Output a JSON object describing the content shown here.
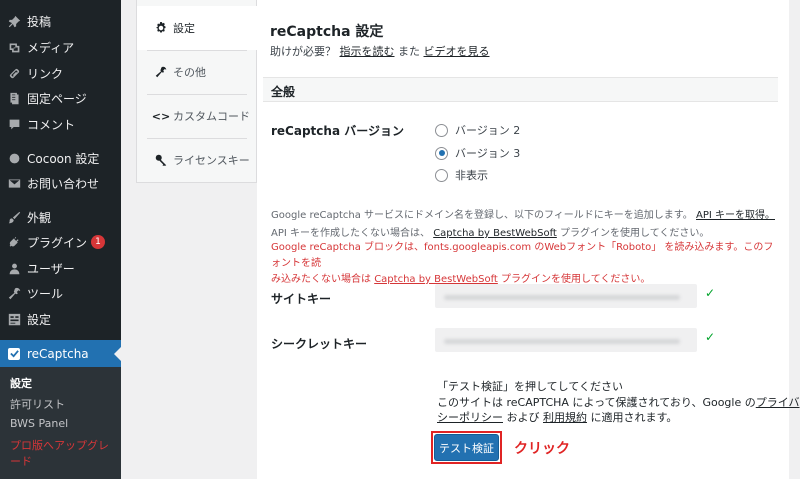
{
  "sidebar": {
    "items": [
      {
        "label": "投稿",
        "icon": "pushpin-icon"
      },
      {
        "label": "メディア",
        "icon": "media-icon"
      },
      {
        "label": "リンク",
        "icon": "link-icon"
      },
      {
        "label": "固定ページ",
        "icon": "page-icon"
      },
      {
        "label": "コメント",
        "icon": "comment-icon"
      },
      {
        "label": "Cocoon 設定",
        "icon": "circle-icon"
      },
      {
        "label": "お問い合わせ",
        "icon": "mail-icon"
      },
      {
        "label": "外観",
        "icon": "brush-icon"
      },
      {
        "label": "プラグイン",
        "icon": "plugin-icon",
        "badge": "1"
      },
      {
        "label": "ユーザー",
        "icon": "user-icon"
      },
      {
        "label": "ツール",
        "icon": "wrench-icon"
      },
      {
        "label": "設定",
        "icon": "settings-icon"
      }
    ],
    "active": {
      "label": "reCaptcha",
      "icon": "checkbox-icon"
    },
    "submenu": [
      "設定",
      "許可リスト",
      "BWS Panel",
      "プロ版へアップグレード"
    ]
  },
  "tabs": [
    {
      "label": "設定",
      "icon": "gear-icon"
    },
    {
      "label": "その他",
      "icon": "wrench-icon"
    },
    {
      "label": "カスタムコード",
      "icon": "code-icon"
    },
    {
      "label": "ライセンスキー",
      "icon": "key-icon"
    }
  ],
  "panel": {
    "title": "reCaptcha 設定",
    "help_prefix": "助けが必要？",
    "help_link1": "指示を読む",
    "help_mid": "また",
    "help_link2": "ビデオを見る",
    "section_title": "全般",
    "version_label": "reCaptcha バージョン",
    "versions": [
      "バージョン 2",
      "バージョン 3",
      "非表示"
    ],
    "selected_version": "バージョン 3",
    "desc1_text": "Google reCaptcha サービスにドメイン名を登録し、以下のフィールドにキーを追加します。",
    "desc1_link": "API キーを取得。",
    "desc2_text": "API キーを作成したくない場合は、",
    "desc2_link": "Captcha by BestWebSoft",
    "desc2_tail": "プラグインを使用してください。",
    "warn_line1": "Google reCaptcha ブロックは、fonts.googleapis.com のWebフォント「Roboto」 を読み込みます。このフォントを読",
    "warn_line2_prefix": "み込みたくない場合は",
    "warn_link": "Captcha by BestWebSoft",
    "warn_line2_tail": "プラグインを使用してください。",
    "site_key_label": "サイトキー",
    "secret_key_label": "シークレットキー",
    "check_mark": "✓",
    "test_line1": "「テスト検証」を押してしてください",
    "test_line2_prefix": "このサイトは reCAPTCHA によって保護されており、Google の",
    "test_link_privacy1": "プライバ",
    "test_link_privacy2": "シーポリシー",
    "test_and": "および",
    "test_link_terms": "利用規約",
    "test_line3_tail": "に適用されます。",
    "test_button": "テスト検証",
    "click_annotation": "クリック"
  },
  "colors": {
    "sidebar_bg": "#1d2327",
    "active_blue": "#2271b1",
    "warning_red": "#d63638",
    "annotation_red": "#e02424",
    "check_green": "#00a32a"
  }
}
